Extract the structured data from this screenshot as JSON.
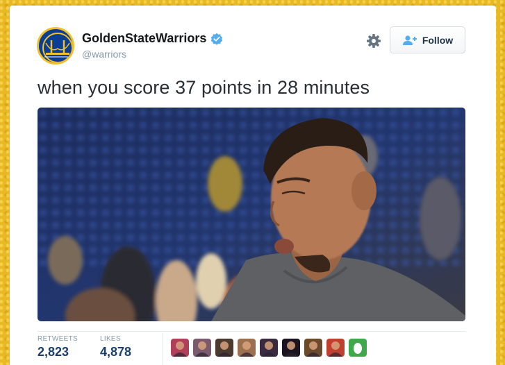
{
  "tweet": {
    "display_name": "GoldenStateWarriors",
    "handle": "@warriors",
    "text": "when you score 37 points in 28 minutes",
    "follow_label": "Follow",
    "avatar_icon": "warriors-logo-icon",
    "verified_icon": "verified-badge-icon",
    "settings_icon": "gear-icon",
    "follow_icon": "add-user-icon"
  },
  "stats": {
    "retweets_label": "RETWEETS",
    "retweets_value": "2,823",
    "likes_label": "LIKES",
    "likes_value": "4,878"
  },
  "likers": [
    {
      "name": "liker-avatar-1",
      "color": "#b0405a"
    },
    {
      "name": "liker-avatar-2",
      "color": "#7a5a6c"
    },
    {
      "name": "liker-avatar-3",
      "color": "#4a3a30"
    },
    {
      "name": "liker-avatar-4",
      "color": "#9b7050"
    },
    {
      "name": "liker-avatar-5",
      "color": "#3a2a40"
    },
    {
      "name": "liker-avatar-6",
      "color": "#1a1420"
    },
    {
      "name": "liker-avatar-7",
      "color": "#6a4a2a"
    },
    {
      "name": "liker-avatar-8",
      "color": "#c04030"
    },
    {
      "name": "liker-avatar-9-default-egg",
      "color": "#3ea84a"
    }
  ],
  "colors": {
    "accent": "#1b3f6b",
    "verified": "#55acee",
    "warriors_blue": "#0b3d91",
    "warriors_gold": "#f1c12b"
  }
}
